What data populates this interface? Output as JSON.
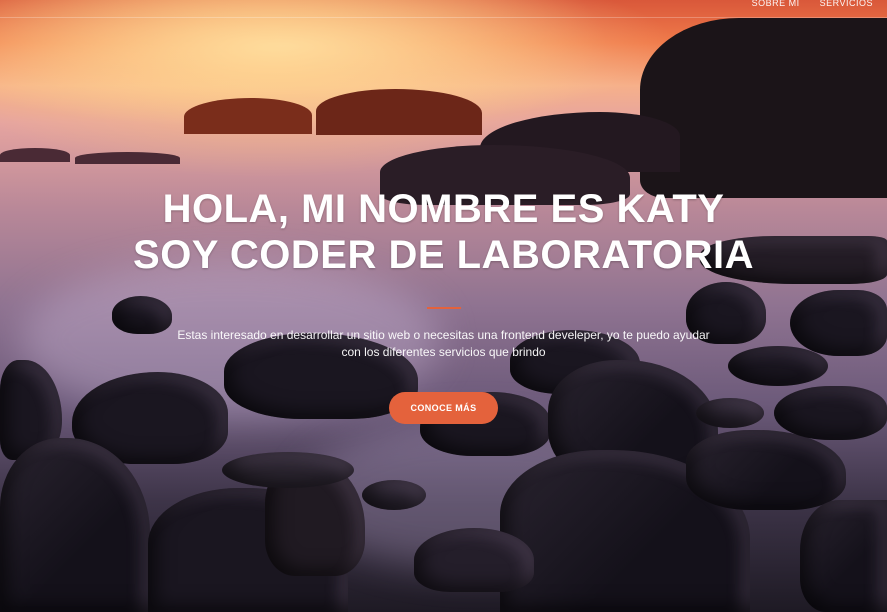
{
  "nav": {
    "items": [
      {
        "label": "SOBRE MI"
      },
      {
        "label": "SERVICIOS"
      }
    ]
  },
  "hero": {
    "headline_line1": "HOLA, MI NOMBRE ES KATY",
    "headline_line2": "SOY CODER DE LABORATORIA",
    "subtitle_line1": "Estas interesado en desarrollar un sitio web o necesitas una frontend develeper, yo te puedo ayudar",
    "subtitle_line2": "con los diferentes servicios que brindo",
    "cta_label": "CONOCE MÁS"
  },
  "colors": {
    "accent": "#e4623c",
    "text": "#ffffff"
  }
}
